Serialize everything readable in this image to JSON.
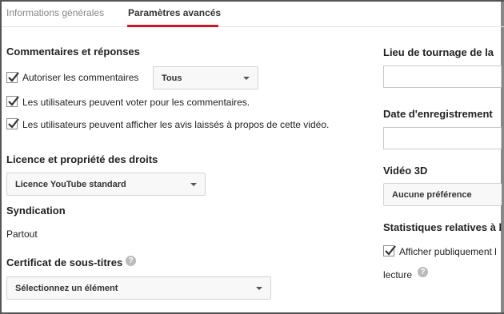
{
  "tabs": {
    "general": "Informations générales",
    "advanced": "Paramètres avancés"
  },
  "comments": {
    "title": "Commentaires et réponses",
    "allow_label": "Autoriser les commentaires",
    "allow_checked": true,
    "filter_value": "Tous",
    "vote_label": "Les utilisateurs peuvent voter pour les commentaires.",
    "vote_checked": true,
    "ratings_label": "Les utilisateurs peuvent afficher les avis laissés à propos de cette vidéo.",
    "ratings_checked": true
  },
  "license": {
    "title": "Licence et propriété des droits",
    "value": "Licence YouTube standard"
  },
  "syndication": {
    "title": "Syndication",
    "value": "Partout"
  },
  "captions": {
    "title": "Certificat de sous-titres",
    "help_icon": "?",
    "value": "Sélectionnez un élément"
  },
  "right": {
    "location_title": "Lieu de tournage de la",
    "recording_title": "Date d'enregistrement",
    "video3d_title": "Vidéo 3D",
    "video3d_value": "Aucune préférence",
    "stats_title": "Statistiques relatives à l",
    "stats_label": "Afficher publiquement l",
    "stats_checked": true,
    "stats_label2": "lecture",
    "help_icon": "?"
  },
  "colors": {
    "accent": "#cc181e",
    "check": "#333333"
  }
}
